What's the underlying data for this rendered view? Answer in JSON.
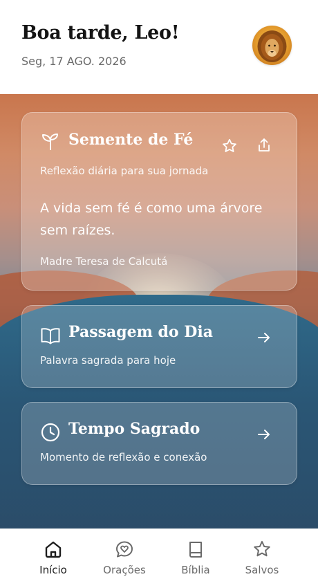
{
  "header": {
    "greeting": "Boa tarde, Leo!",
    "date": "Seg, 17 AGO. 2026"
  },
  "cards": {
    "seed": {
      "title": "Semente de Fé",
      "subtitle": "Reflexão diária para sua jornada",
      "quote": "A vida sem fé é como uma árvore sem raízes.",
      "author": "Madre Teresa de Calcutá",
      "icons": [
        "sprout-icon",
        "star-icon",
        "share-icon"
      ]
    },
    "passage": {
      "title": "Passagem do Dia",
      "subtitle": "Palavra sagrada para hoje",
      "icons": [
        "book-open-icon",
        "arrow-right-icon"
      ]
    },
    "time": {
      "title": "Tempo Sagrado",
      "subtitle": "Momento de reflexão e conexão",
      "icons": [
        "clock-icon",
        "arrow-right-icon"
      ]
    }
  },
  "nav": {
    "items": [
      {
        "label": "Início",
        "icon": "home-icon",
        "active": true
      },
      {
        "label": "Orações",
        "icon": "prayer-chat-icon",
        "active": false
      },
      {
        "label": "Bíblia",
        "icon": "book-icon",
        "active": false
      },
      {
        "label": "Salvos",
        "icon": "star-icon",
        "active": false
      }
    ]
  },
  "colors": {
    "text_dark": "#141414",
    "text_muted": "#6b6b6b",
    "card_text": "#ffffff"
  }
}
